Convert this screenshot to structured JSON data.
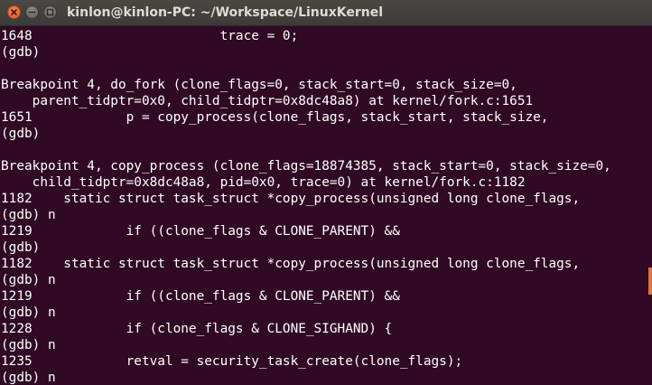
{
  "window": {
    "title": "kinlon@kinlon-PC: ~/Workspace/LinuxKernel"
  },
  "icons": {
    "close": "close-icon",
    "minimize": "minimize-icon",
    "maximize": "maximize-icon"
  },
  "colors": {
    "terminal_bg": "#300a24",
    "text": "#ffffff",
    "close_button": "#e35a1f",
    "scroll_thumb": "#e4743e"
  },
  "terminal": {
    "lines": [
      "1648                        trace = 0;",
      "(gdb)",
      "",
      "Breakpoint 4, do_fork (clone_flags=0, stack_start=0, stack_size=0,",
      "    parent_tidptr=0x0, child_tidptr=0x8dc48a8) at kernel/fork.c:1651",
      "1651            p = copy_process(clone_flags, stack_start, stack_size,",
      "(gdb)",
      "",
      "Breakpoint 4, copy_process (clone_flags=18874385, stack_start=0, stack_size=0,",
      "    child_tidptr=0x8dc48a8, pid=0x0, trace=0) at kernel/fork.c:1182",
      "1182    static struct task_struct *copy_process(unsigned long clone_flags,",
      "(gdb) n",
      "1219            if ((clone_flags & CLONE_PARENT) &&",
      "(gdb)",
      "1182    static struct task_struct *copy_process(unsigned long clone_flags,",
      "(gdb) n",
      "1219            if ((clone_flags & CLONE_PARENT) &&",
      "(gdb) n",
      "1228            if (clone_flags & CLONE_SIGHAND) {",
      "(gdb) n",
      "1235            retval = security_task_create(clone_flags);",
      "(gdb) n"
    ]
  }
}
